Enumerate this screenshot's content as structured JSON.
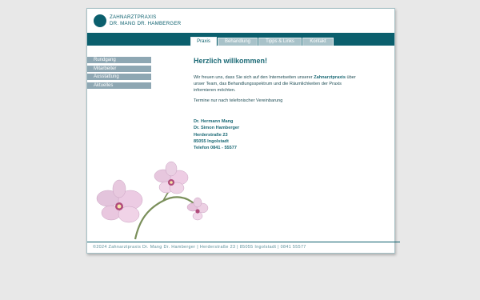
{
  "header": {
    "logo_line1": "ZAHNARZTPRAXIS",
    "logo_line2": "DR. MANG DR. HAMBERGER"
  },
  "nav": {
    "tabs": [
      {
        "label": "Praxis",
        "active": true
      },
      {
        "label": "Behandlung"
      },
      {
        "label": "Tipps & Links"
      },
      {
        "label": "Kontakt"
      }
    ]
  },
  "sidebar": {
    "items": [
      {
        "label": "Rundgang"
      },
      {
        "label": "Mitarbeiter"
      },
      {
        "label": "Ausstattung"
      },
      {
        "label": "Aktuelles"
      }
    ]
  },
  "main": {
    "heading": "Herzlich willkommen!",
    "intro_part1": "Wir freuen uns, dass Sie sich auf den Internetseiten unserer",
    "intro_link": "Zahnarztpraxis",
    "intro_part2": "über unser Team, das Behandlungsspektrum und die Räumlichkeiten der Praxis informieren möchten.",
    "appointment": "Termine nur nach telefonischer Vereinbarung",
    "address": {
      "name1": "Dr. Hermann Mang",
      "name2": "Dr. Simon Hamberger",
      "street": "Herderstraße 23",
      "city": "85055 Ingolstadt",
      "phone": "Telefon 0841 - 55577"
    }
  },
  "footer": {
    "text": "©2024 Zahnarztpraxis Dr. Mang Dr. Hamberger | Herderstraße 23 | 85055 Ingolstadt | 0841 55577"
  },
  "colors": {
    "primary": "#0b5f6d",
    "tab": "#a8c2c9",
    "sidebar": "#8ea7b3",
    "background": "#e8e8e8"
  }
}
